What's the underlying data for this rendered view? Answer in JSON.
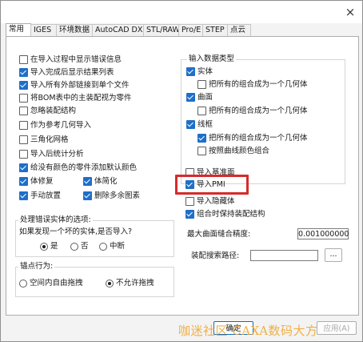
{
  "window": {
    "close_glyph": "×"
  },
  "tabs": [
    {
      "label": "常用",
      "active": true
    },
    {
      "label": "IGES"
    },
    {
      "label": "环境数据"
    },
    {
      "label": "AutoCAD DXF"
    },
    {
      "label": "STL/RAW"
    },
    {
      "label": "Pro/E"
    },
    {
      "label": "STEP"
    },
    {
      "label": "点云"
    }
  ],
  "left_options": [
    {
      "label": "在导入过程中显示错误信息",
      "checked": false
    },
    {
      "label": "导入完成后显示结果列表",
      "checked": true
    },
    {
      "label": "导入所有外部链接到单个文件",
      "checked": true
    },
    {
      "label": "将BOM表中的主装配视为零件",
      "checked": false
    },
    {
      "label": "忽略装配结构",
      "checked": false
    },
    {
      "label": "作为参考几何导入",
      "checked": false
    },
    {
      "label": "三角化网格",
      "checked": false
    },
    {
      "label": "导入后统计分析",
      "checked": false
    },
    {
      "label": "给没有颜色的零件添加默认颜色",
      "checked": true
    }
  ],
  "paired_options": [
    {
      "label": "体修复",
      "checked": true
    },
    {
      "label": "体简化",
      "checked": true
    },
    {
      "label": "手动放置",
      "checked": true
    },
    {
      "label": "删除多余图素",
      "checked": true
    }
  ],
  "error_group": {
    "title": "处理错误实体的选项:",
    "question": "如果发现一个坏的实体,是否导入?",
    "options": [
      {
        "label": "是",
        "selected": true
      },
      {
        "label": "否",
        "selected": false
      },
      {
        "label": "中断",
        "selected": false
      }
    ]
  },
  "anchor_group": {
    "title": "锚点行为:",
    "options": [
      {
        "label": "空间内自由拖拽",
        "selected": false
      },
      {
        "label": "不允许拖拽",
        "selected": true
      }
    ]
  },
  "import_types": {
    "title": "输入数据类型",
    "items": [
      {
        "label": "实体",
        "checked": true
      },
      {
        "label": "把所有的组合成为一个几何体",
        "checked": false
      },
      {
        "label": "曲面",
        "checked": true
      },
      {
        "label": "把所有的组合成为一个几何体",
        "checked": false
      },
      {
        "label": "线框",
        "checked": true
      },
      {
        "label": "把所有的组合成为一个几何体",
        "checked": true
      },
      {
        "label": "按照曲线颜色组合",
        "checked": false
      }
    ]
  },
  "right_options": [
    {
      "label": "导入基准面",
      "checked": false
    },
    {
      "label": "导入PMI",
      "checked": true
    },
    {
      "label": "导入隐藏体",
      "checked": false
    },
    {
      "label": "组合时保持装配结构",
      "checked": true
    }
  ],
  "max_gap": {
    "label": "最大曲面缝合精度:",
    "value": "0.001000000"
  },
  "search_path": {
    "label": "装配搜索路径:",
    "value": "",
    "browse": "..."
  },
  "footer": {
    "ok": "确定",
    "apply": "应用(A)"
  },
  "watermark_text": "咖迷社区  CAXA数码大方",
  "colors": {
    "accent": "#1f6fc8",
    "highlight": "#d62b2b",
    "watermark": "#f2a830"
  }
}
